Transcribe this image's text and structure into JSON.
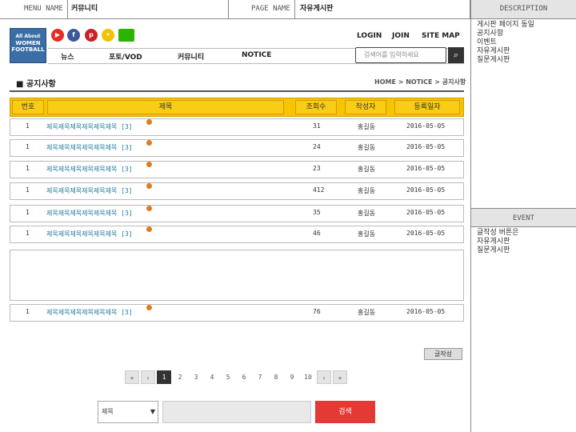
{
  "meta": {
    "menu_name_label": "MENU NAME",
    "menu_name_value": "커뮤니티",
    "page_name_label": "PAGE NAME",
    "page_name_value": "자유게시판",
    "description_label": "DESCRIPTION"
  },
  "description": {
    "lines": [
      "게시판 페이지 동일",
      "공지사항",
      "이벤트",
      "자유게시판",
      "질문게시판"
    ]
  },
  "event": {
    "title": "EVENT",
    "lines": [
      "글작성 버튼은",
      "자유게시판",
      "질문게시판"
    ]
  },
  "logo": {
    "line1": "All About",
    "line2": "WOMEN",
    "line3": "FOOTBALL"
  },
  "sns": [
    {
      "icon": "youtube-icon",
      "glyph": "▶",
      "color": "#e52d27"
    },
    {
      "icon": "facebook-icon",
      "glyph": "f",
      "color": "#3b5998"
    },
    {
      "icon": "pinterest-icon",
      "glyph": "p",
      "color": "#cb2027"
    },
    {
      "icon": "kakao-icon",
      "glyph": "•",
      "color": "#f2c200"
    },
    {
      "icon": "blog-icon",
      "glyph": "b",
      "color": "#2db400"
    }
  ],
  "gnb": {
    "login": "LOGIN",
    "join": "JOIN",
    "sitemap": "SITE MAP"
  },
  "menu": [
    "뉴스",
    "포토/VOD",
    "커뮤니티",
    "NOTICE"
  ],
  "search": {
    "placeholder": "검색어를 입력하세요"
  },
  "page_title": "■ 공지사항",
  "breadcrumb": "HOME > NOTICE > 공지사항",
  "table": {
    "headers": [
      "번호",
      "제목",
      "조회수",
      "작성자",
      "등록일자"
    ],
    "rows": [
      {
        "no": "1",
        "title": "제목제목제목제목제목제목 [3]",
        "views": "31",
        "author": "홍길동",
        "date": "2016-05-05"
      },
      {
        "no": "1",
        "title": "제목제목제목제목제목제목 [3]",
        "views": "24",
        "author": "홍길동",
        "date": "2016-05-05"
      },
      {
        "no": "1",
        "title": "제목제목제목제목제목제목 [3]",
        "views": "23",
        "author": "홍길동",
        "date": "2016-05-05"
      },
      {
        "no": "1",
        "title": "제목제목제목제목제목제목 [3]",
        "views": "412",
        "author": "홍길동",
        "date": "2016-05-05"
      },
      {
        "no": "1",
        "title": "제목제목제목제목제목제목 [3]",
        "views": "35",
        "author": "홍길동",
        "date": "2016-05-05"
      },
      {
        "no": "1",
        "title": "제목제목제목제목제목제목 [3]",
        "views": "46",
        "author": "홍길동",
        "date": "2016-05-05"
      },
      {
        "no": "1",
        "title": "제목제목제목제목제목제목 [3]",
        "views": "76",
        "author": "홍길동",
        "date": "2016-05-05"
      }
    ]
  },
  "write_button": "글작성",
  "pagination": {
    "first": "«",
    "prev": "‹",
    "pages": [
      "1",
      "2",
      "3",
      "4",
      "5",
      "6",
      "7",
      "8",
      "9",
      "10"
    ],
    "current": "1",
    "next": "›",
    "last": "»"
  },
  "bottom_search": {
    "select_value": "제목",
    "submit": "검색"
  }
}
